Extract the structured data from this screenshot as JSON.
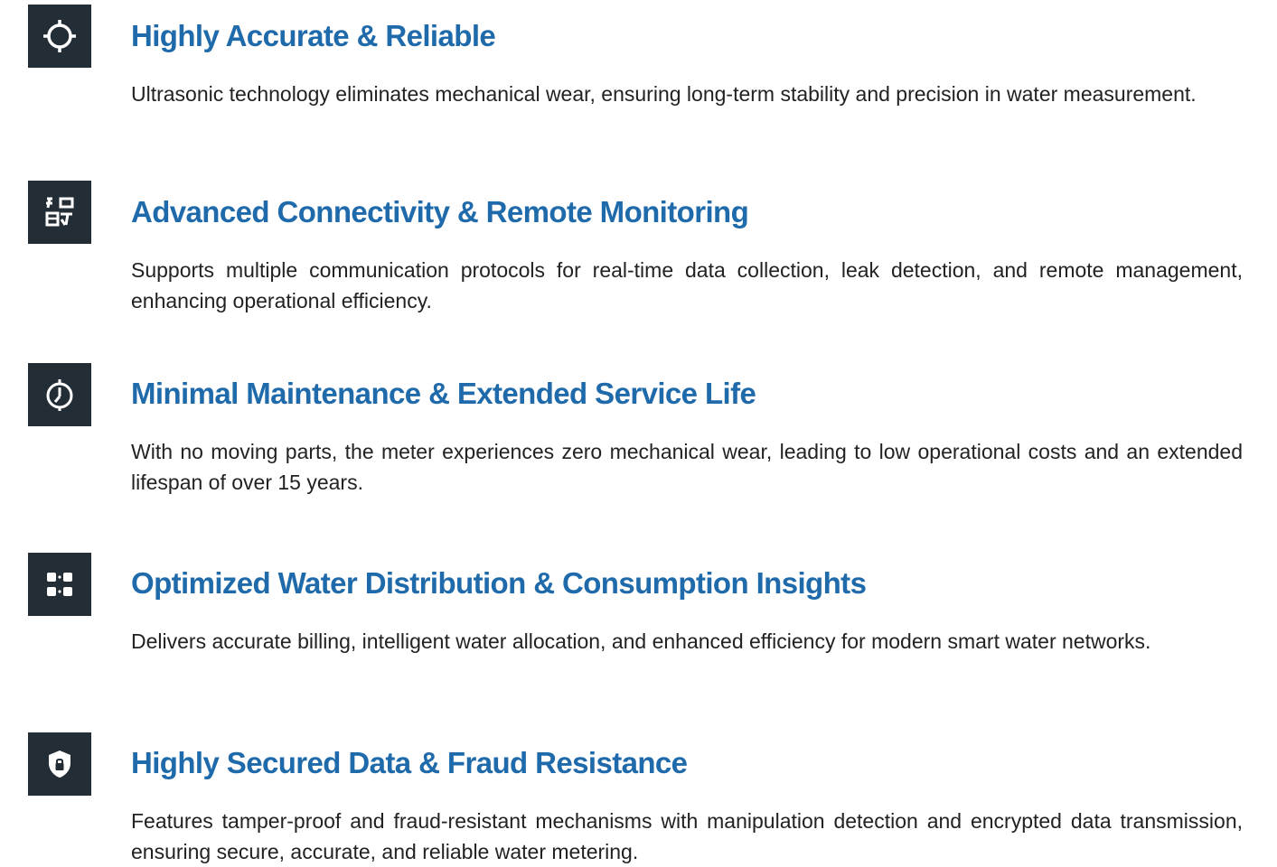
{
  "features": [
    {
      "icon": "crosshair-target-icon",
      "title": "Highly Accurate & Reliable",
      "description": "Ultrasonic technology eliminates mechanical wear, ensuring long-term stability and precision in water measurement."
    },
    {
      "icon": "network-connectivity-icon",
      "title": "Advanced Connectivity & Remote Monitoring",
      "description": "Supports multiple communication protocols for real-time data collection, leak detection, and remote management, enhancing operational efficiency."
    },
    {
      "icon": "clock-timer-icon",
      "title": "Minimal Maintenance & Extended Service Life",
      "description": "With no moving parts, the meter experiences zero mechanical wear, leading to low operational costs and an extended lifespan of over 15 years."
    },
    {
      "icon": "distribution-nodes-icon",
      "title": "Optimized Water Distribution & Consumption Insights",
      "description": "Delivers accurate billing, intelligent water allocation, and enhanced efficiency for modern smart water networks."
    },
    {
      "icon": "shield-lock-icon",
      "title": "Highly Secured Data & Fraud Resistance",
      "description": "Features tamper-proof and fraud-resistant mechanisms with manipulation detection and encrypted data transmission, ensuring secure, accurate, and reliable water metering."
    }
  ],
  "colors": {
    "title": "#1f6aaa",
    "icon_background": "#232d36",
    "icon_foreground": "#ffffff",
    "text": "#222222"
  }
}
